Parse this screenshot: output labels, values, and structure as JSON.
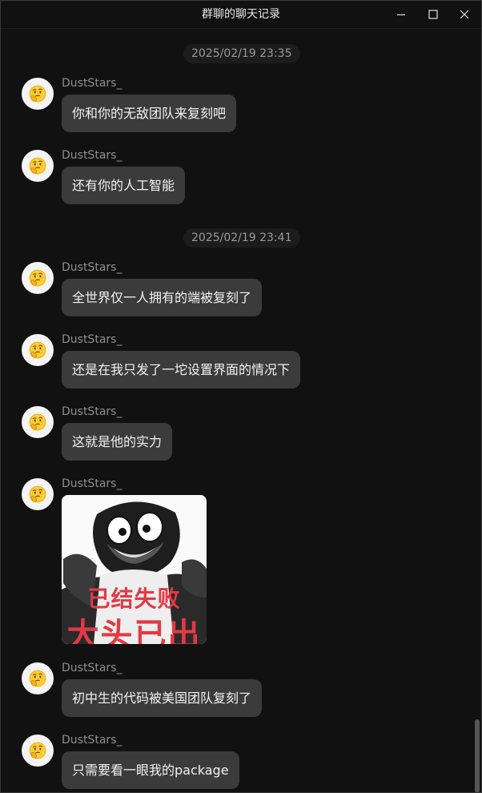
{
  "window": {
    "title": "群聊的聊天记录"
  },
  "timestamps": [
    "2025/02/19 23:35",
    "2025/02/19 23:41"
  ],
  "messages": [
    {
      "sender": "DustStars_",
      "text": "你和你的无敌团队来复刻吧"
    },
    {
      "sender": "DustStars_",
      "text": "还有你的人工智能"
    },
    {
      "sender": "DustStars_",
      "text": "全世界仅一人拥有的端被复刻了"
    },
    {
      "sender": "DustStars_",
      "text": "还是在我只发了一坨设置界面的情况下"
    },
    {
      "sender": "DustStars_",
      "text": "这就是他的实力"
    },
    {
      "sender": "DustStars_",
      "sticker": {
        "caption_top": "已结失败",
        "caption_bottom": "大头已出"
      }
    },
    {
      "sender": "DustStars_",
      "text": "初中生的代码被美国团队复刻了"
    },
    {
      "sender": "DustStars_",
      "text": "只需要看一眼我的package"
    }
  ],
  "icons": {
    "avatar": "thinking-face-emoji",
    "minimize": "minimize-icon",
    "maximize": "maximize-icon",
    "close": "close-icon"
  },
  "colors": {
    "background": "#111111",
    "bubble": "#3b3b3b",
    "sticker_caption": "#e23a45"
  }
}
